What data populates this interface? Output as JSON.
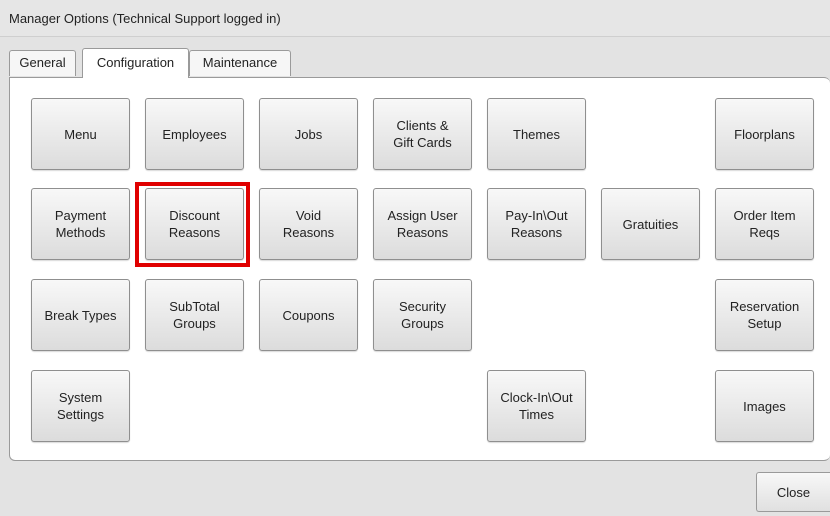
{
  "window": {
    "title": "Manager Options (Technical Support logged in)"
  },
  "tabs": [
    {
      "label": "General"
    },
    {
      "label": "Configuration",
      "active": true
    },
    {
      "label": "Maintenance"
    }
  ],
  "buttons": {
    "menu": "Menu",
    "employees": "Employees",
    "jobs": "Jobs",
    "clients_gift_cards": "Clients &\nGift Cards",
    "themes": "Themes",
    "floorplans": "Floorplans",
    "payment_methods": "Payment\nMethods",
    "discount_reasons": "Discount\nReasons",
    "void_reasons": "Void\nReasons",
    "assign_user_reasons": "Assign User\nReasons",
    "pay_in_out_reasons": "Pay-In\\Out\nReasons",
    "gratuities": "Gratuities",
    "order_item_reqs": "Order Item\nReqs",
    "break_types": "Break Types",
    "subtotal_groups": "SubTotal\nGroups",
    "coupons": "Coupons",
    "security_groups": "Security\nGroups",
    "reservation_setup": "Reservation\nSetup",
    "system_settings": "System\nSettings",
    "clock_in_out_times": "Clock-In\\Out\nTimes",
    "images": "Images"
  },
  "footer": {
    "close_label": "Close"
  },
  "colors": {
    "highlight": "#e00000",
    "titlebar": "#e6e6e6",
    "client_bg": "#e3e3e3"
  }
}
